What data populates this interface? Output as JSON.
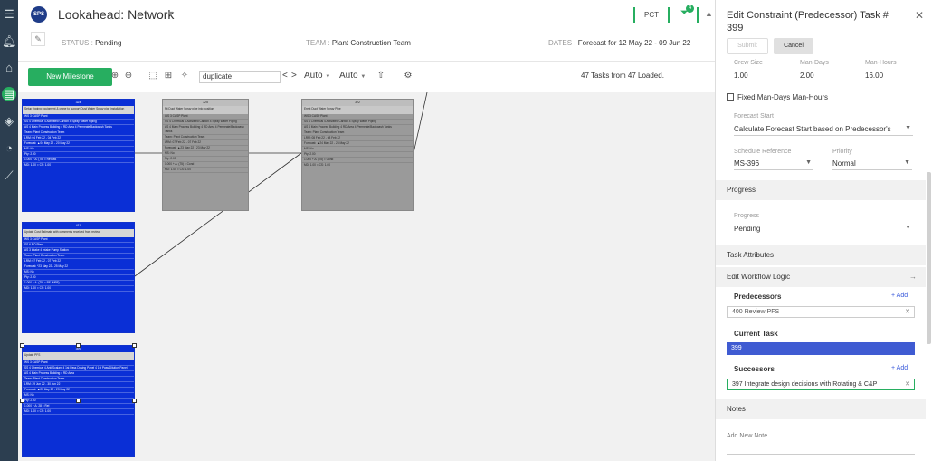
{
  "app": {
    "logo": "SPS",
    "title": "Lookahead: Network",
    "pct_label": "PCT",
    "filter_count": "4"
  },
  "status_bar": {
    "status_key": "STATUS :",
    "status_value": "Pending",
    "team_key": "TEAM :",
    "team_value": "Plant Construction Team",
    "dates_key": "DATES :",
    "dates_value": "Forecast for 12 May 22 - 09 Jun 22"
  },
  "toolbar": {
    "new_milestone": "New Milestone",
    "search_value": "duplicate",
    "nav_prev": "<",
    "nav_next": ">",
    "auto1": "Auto",
    "auto2": "Auto",
    "loaded": "47 Tasks from 47 Loaded."
  },
  "cards": [
    {
      "num": "324",
      "name": "Setup rigging equipment & crane to support Dust Water Spray pipe installation",
      "rows": [
        "WS 3 CASP Plant",
        "SS 4 Chemical 4 Activated Carbon 4 Spray Water Piping",
        "AS 4 Main Process Building 4 RD Area 4 Permeate/Backwash Tanks",
        "Team: Plant Construction Team",
        "LRM: 04 Feb 22 - 04 Feb 22",
        "Forecast: ▲04 May 22 - 20 May 22",
        "MS: No",
        "Pty: 2.00",
        "1.000 + Δ: (75) = Ret MB",
        "MD: 1.00 = CS: 1.00"
      ]
    },
    {
      "num": "325",
      "name": "Fit Duct Water Spray pipe into position",
      "rows": [
        "WS 3 CASP Plant",
        "SS 4 Chemical 4 Activated Carbon 4 Spray Water Piping",
        "AS 4 Main Process Building 4 RD Area 4 Permeate/Backwash Tanks",
        "Team: Plant Construction Team",
        "LRM: 07 Feb 22 - 07 Feb 22",
        "Forecast: ▲23 May 22 - 23 May 22",
        "MS: No",
        "Pty: 2.00",
        "1.000 + Δ: (75) = Cond",
        "MD: 1.00 = CS: 1.00"
      ]
    },
    {
      "num": "322",
      "name": "Erect Duct Water Spray Pipe",
      "rows": [
        "WS 3 CASP Plant",
        "SS 4 Chemical 4 Activated Carbon 4 Spray Water Piping",
        "AS 4 Main Process Building 4 RD Area 4 Permeate/Backwash Tanks",
        "Team: Plant Construction Team",
        "LRM: 08 Feb 22 - 08 Feb 22",
        "Forecast: ▲24 May 22 - 24 May 22",
        "MS: No",
        "Pty: 2.00",
        "1.000 + Δ: (75) = Cond",
        "MD: 1.00 = CS: 1.00"
      ]
    },
    {
      "num": "411",
      "name": "Update Cost Estimate with comments received from review",
      "rows": [
        "WS 3 CASP Plant",
        "SS 6 RO Plant",
        "AS 3 Intake 4 Intake Pump Station",
        "Team: Plant Construction Team",
        "LRM: 07 Feb 22 - 07 Feb 22",
        "Forecast: *23 May 22 - 25 May 22",
        "MS: No",
        "Pty: 2.00",
        "1.000 + Δ: (75) = RF (MPF)",
        "MD: 1.00 = CS: 1.00"
      ]
    },
    {
      "num": "399",
      "name": "Update PFS",
      "rows": [
        "WS 3 CASP Plant",
        "SS 4 Chemical 4 Anti-Scalant 4 1st Pass Dosing Panel 4 1st Pass Dilution Panel",
        "AS 4 Main Process Building 4 RD Area",
        "Team: Plant Construction Team",
        "LRM: 29 Jun 22 - 30 Jun 22",
        "Forecast: ▲20 May 22 - 23 May 22",
        "MS: No",
        "Pty: 2.00",
        "1.000 + Δ: 28 = Rel",
        "MD: 1.00 = CS: 1.00"
      ]
    }
  ],
  "panel": {
    "title": "Edit Constraint (Predecessor) Task # 399",
    "submit": "Submit",
    "cancel": "Cancel",
    "crew_size_label": "Crew Size",
    "crew_size_value": "1.00",
    "man_days_label": "Man-Days",
    "man_days_value": "2.00",
    "man_hours_label": "Man-Hours",
    "man_hours_value": "16.00",
    "fixed_label": "Fixed Man-Days Man-Hours",
    "forecast_start_label": "Forecast Start",
    "forecast_start_value": "Calculate Forecast Start based on Predecessor's",
    "schedule_ref_label": "Schedule Reference",
    "schedule_ref_value": "MS-396",
    "priority_label": "Priority",
    "priority_value": "Normal",
    "progress_section": "Progress",
    "progress_label": "Progress",
    "progress_value": "Pending",
    "task_attributes": "Task Attributes",
    "workflow_logic": "Edit Workflow Logic",
    "predecessors": "Predecessors",
    "add": "+ Add",
    "predecessor_item": "400 Review PFS",
    "current_task": "Current Task",
    "current_task_value": "399",
    "successors": "Successors",
    "successor_item": "397 Integrate design decisions with Rotating & C&P",
    "notes": "Notes",
    "add_note_placeholder": "Add New Note"
  },
  "colors": {
    "accent": "#27ae60",
    "card_blue": "#0a2fd6",
    "card_grey": "#9a9a9a",
    "sidebar": "#2c3e50"
  }
}
